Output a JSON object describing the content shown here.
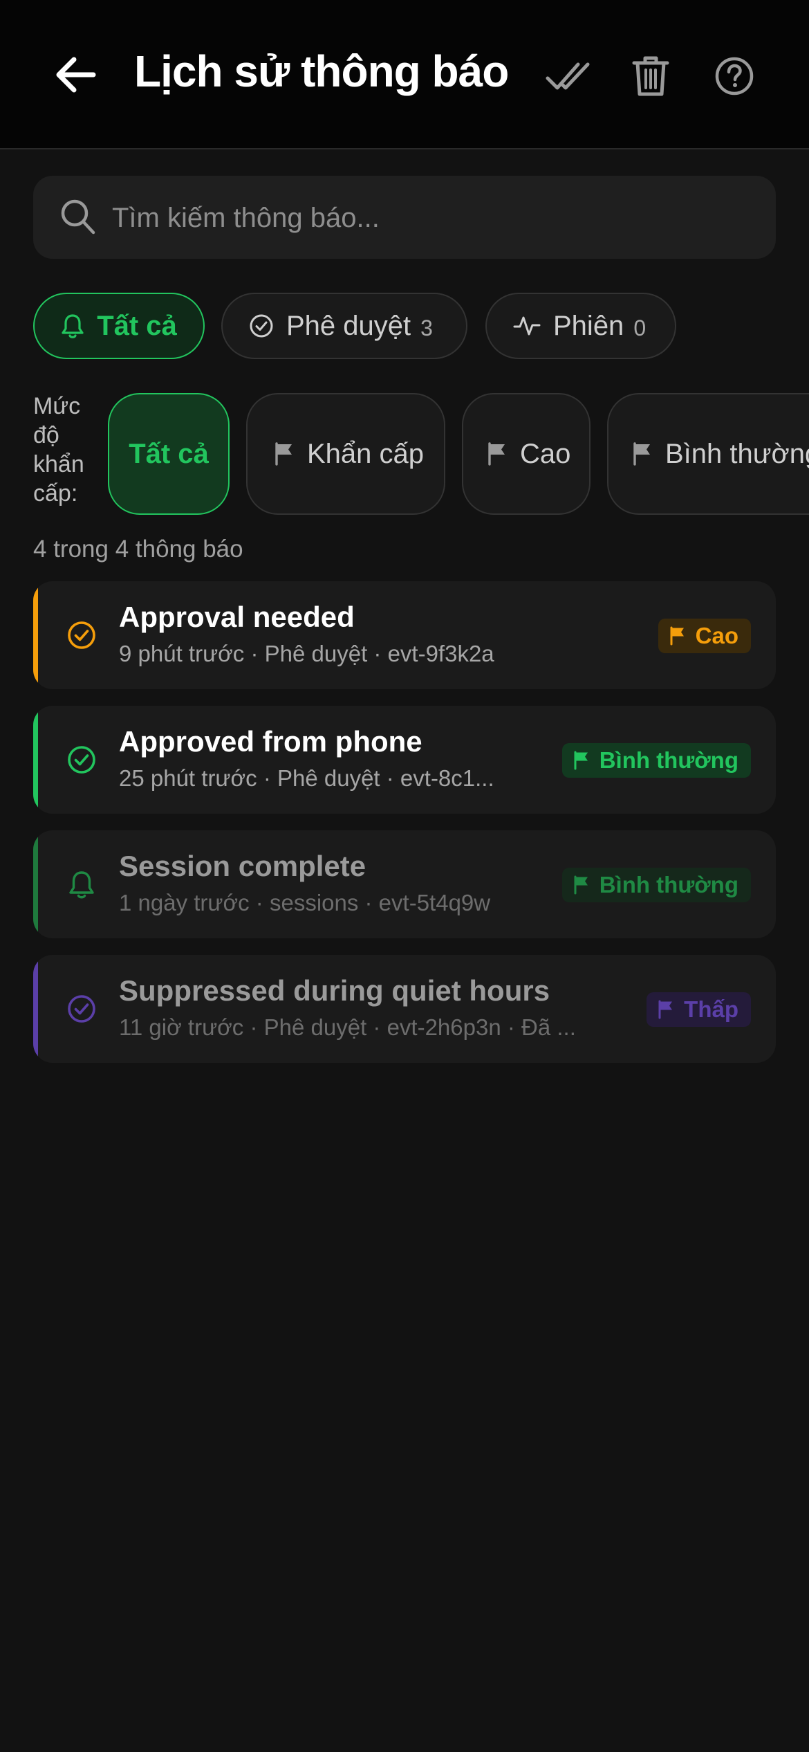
{
  "header": {
    "title": "Lịch sử thông báo",
    "back_icon": "arrow-left-icon",
    "actions": [
      "mark-all-read-icon",
      "trash-icon",
      "help-icon"
    ]
  },
  "search": {
    "placeholder": "Tìm kiếm thông báo..."
  },
  "type_tabs": [
    {
      "label": "Tất cả",
      "count": "",
      "icon": "bell-icon",
      "active": true
    },
    {
      "label": "Phê duyệt",
      "count": "3",
      "icon": "check-circle-icon",
      "active": false
    },
    {
      "label": "Phiên",
      "count": "0",
      "icon": "activity-icon",
      "active": false
    }
  ],
  "priority": {
    "label": "Mức độ khẩn cấp:",
    "options": [
      {
        "label": "Tất cả",
        "active": true
      },
      {
        "label": "Khẩn cấp",
        "active": false
      },
      {
        "label": "Cao",
        "active": false
      },
      {
        "label": "Bình thường",
        "active": false
      }
    ]
  },
  "summary": "4 trong 4 thông báo",
  "notifications": [
    {
      "title": "Approval needed",
      "meta": "9 phút trước · Phê duyệt · evt-9f3k2a",
      "priority": "Cao",
      "icon": "check-circle-icon",
      "accent": "#f59e0b",
      "dim": false
    },
    {
      "title": "Approved from phone",
      "meta": "25 phút trước · Phê duyệt · evt-8c1...",
      "priority": "Bình thường",
      "icon": "check-circle-icon",
      "accent": "#22c55e",
      "dim": false
    },
    {
      "title": "Session complete",
      "meta": "1 ngày trước · sessions · evt-5t4q9w",
      "priority": "Bình thường",
      "icon": "bell-icon",
      "accent": "#1f7a3d",
      "dim": true
    },
    {
      "title": "Suppressed during quiet hours",
      "meta": "11 giờ trước · Phê duyệt · evt-2h6p3n · Đã ...",
      "priority": "Thấp",
      "icon": "check-circle-icon",
      "accent": "#5b3fa8",
      "dim": true
    }
  ],
  "colors": {
    "green": "#22c55e",
    "orange": "#f59e0b",
    "purple": "#6d4bc4",
    "background": "#121212"
  }
}
